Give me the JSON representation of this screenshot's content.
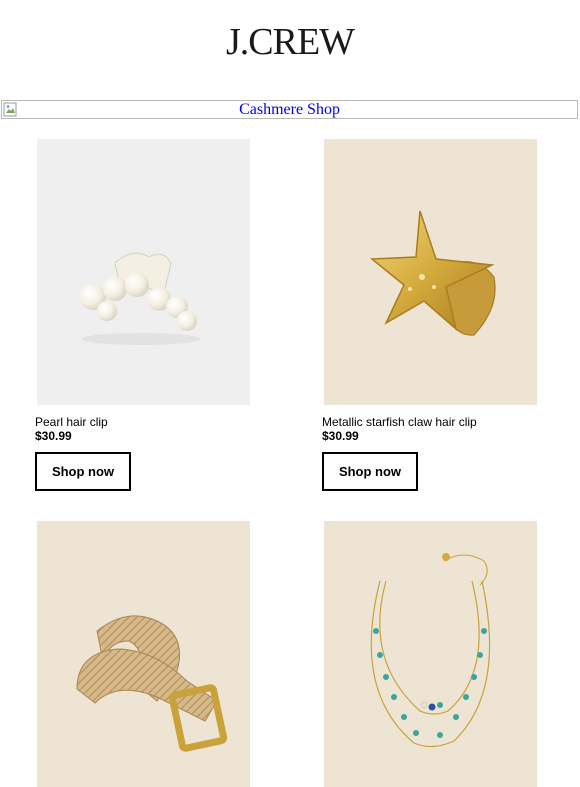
{
  "header": {
    "brand": "J.CREW"
  },
  "banner": {
    "alt_text": "Cashmere Shop"
  },
  "products": [
    {
      "name": "Pearl hair clip",
      "price": "$30.99",
      "cta": "Shop now",
      "background": "#efefef",
      "icon": "pearl-hair-clip"
    },
    {
      "name": "Metallic starfish claw hair clip",
      "price": "$30.99",
      "cta": "Shop now",
      "background": "#ede4d4",
      "icon": "starfish-hair-clip"
    },
    {
      "background": "#ede4d4",
      "icon": "woven-raffia-belt"
    },
    {
      "background": "#ede4d4",
      "icon": "layered-bead-necklace"
    }
  ],
  "colors": {
    "link": "#0000ee",
    "gold": "#d4aa3c",
    "pearl": "#f6f1e4",
    "raffia": "#d6b98a",
    "turquoise": "#3aa59a"
  }
}
